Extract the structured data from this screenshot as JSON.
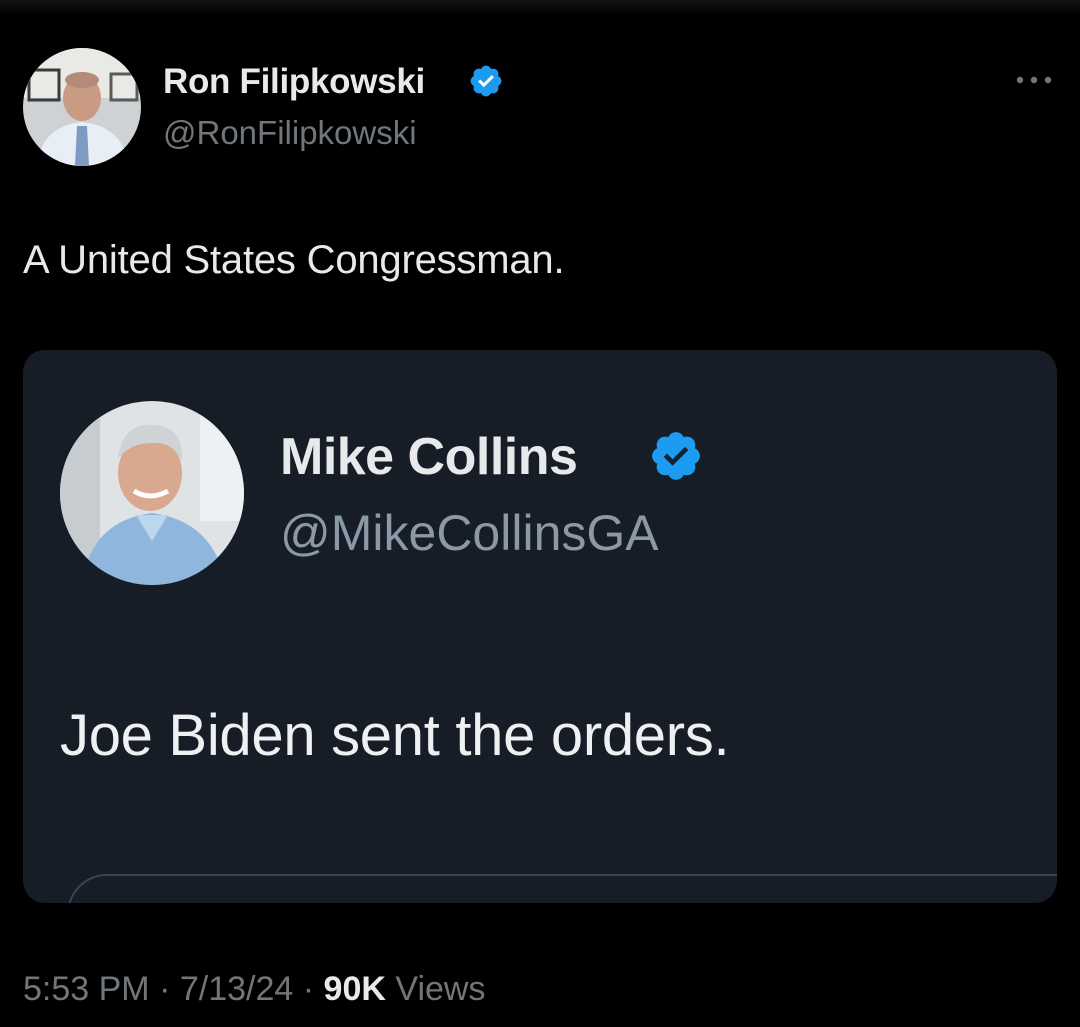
{
  "tweet": {
    "author": {
      "name": "Ron Filipkowski",
      "handle": "@RonFilipkowski",
      "verified": true,
      "verified_color": "#1d9bf0"
    },
    "text": "A United States Congressman.",
    "quoted": {
      "author": {
        "name": "Mike Collins",
        "handle": "@MikeCollinsGA",
        "verified": true
      },
      "text": "Joe Biden sent the orders."
    },
    "meta": {
      "time": "5:53 PM",
      "separator": "·",
      "date": "7/13/24",
      "views_count": "90K",
      "views_label": "Views"
    }
  },
  "colors": {
    "background": "#000000",
    "card_background": "#161d27",
    "primary_text": "#e7e9ea",
    "secondary_text": "#71767b",
    "accent": "#1d9bf0"
  },
  "icons": {
    "verified": "verified-badge-icon",
    "more": "more-horizontal-icon"
  }
}
